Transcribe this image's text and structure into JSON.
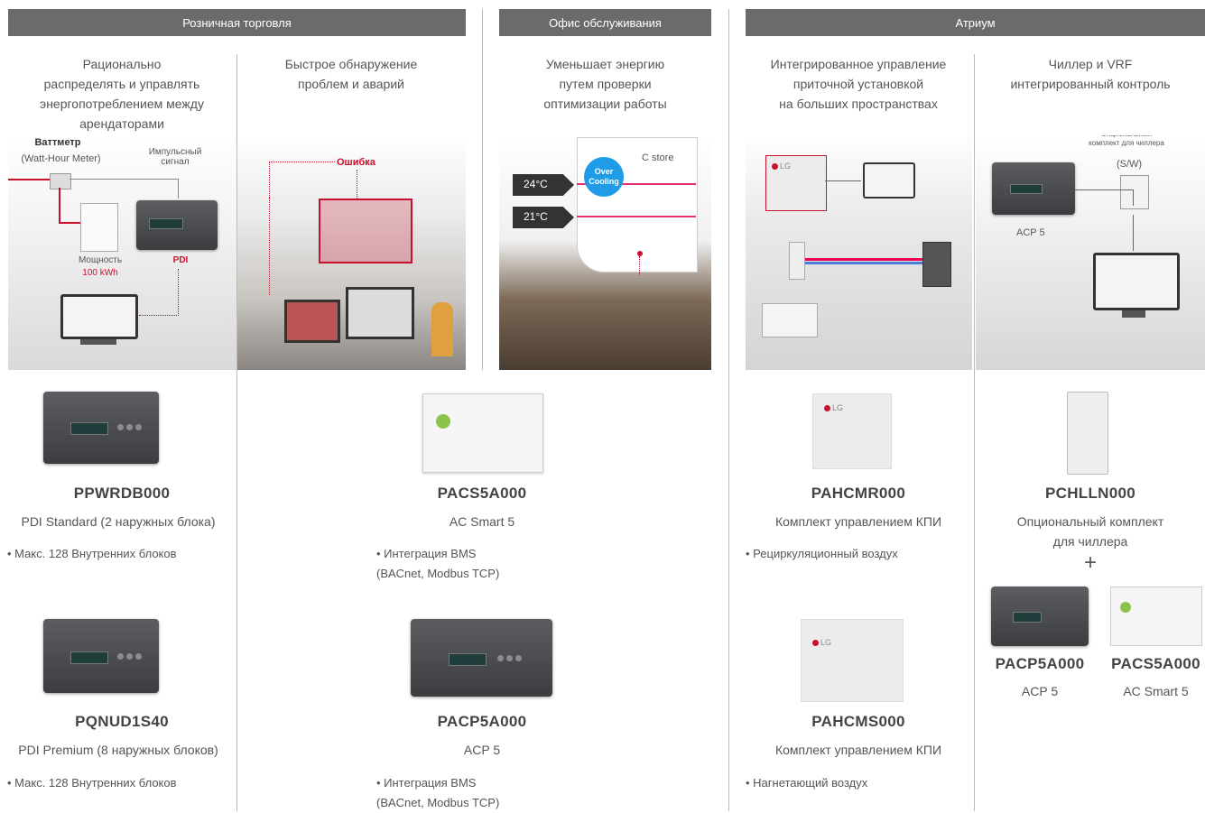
{
  "headers": {
    "retail": "Розничная торговля",
    "office": "Офис обслуживания",
    "atrium": "Атриум"
  },
  "columns": {
    "col1": {
      "desc": "Рационально\nраспределять и управлять\nэнергопотреблением между\nарендаторами",
      "diagram": {
        "wattmeter_title": "Ваттметр",
        "wattmeter_sub": "(Watt-Hour Meter)",
        "pulse": "Импульсный\nсигнал",
        "power_label": "Мощность",
        "power_value": "100 kWh",
        "pdi": "PDI"
      }
    },
    "col2": {
      "desc": "Быстрое обнаружение\nпроблем и аварий",
      "error_label": "Ошибка"
    },
    "col3": {
      "desc": "Уменьшает энергию\nпутем проверки\nоптимизации работы",
      "temp_high": "24°C",
      "temp_low": "21°C",
      "bubble": "Over\nCooling",
      "store": "C store"
    },
    "col4": {
      "desc": "Интегрированное управление\nприточной установкой\nна больших пространствах",
      "logo": "LG"
    },
    "col5": {
      "desc": "Чиллер и VRF\nинтегрированный контроль",
      "option_kit": "Опциональный\nкомплект для чиллера",
      "sw": "(S/W)",
      "acp": "ACP 5"
    }
  },
  "products": {
    "ppwrdb": {
      "code": "PPWRDB000",
      "name": "PDI Standard (2 наружных блока)",
      "bullet": "• Макс. 128 Внутренних блоков"
    },
    "pqnud": {
      "code": "PQNUD1S40",
      "name": "PDI Premium (8 наружных блоков)",
      "bullet": "• Макс. 128 Внутренних блоков"
    },
    "pacs5": {
      "code": "PACS5A000",
      "name": "AC Smart 5",
      "bullet": "• Интеграция BMS\n  (BACnet, Modbus TCP)"
    },
    "pacp5": {
      "code": "PACP5A000",
      "name": "ACP 5",
      "bullet": "• Интеграция BMS\n  (BACnet, Modbus TCP)"
    },
    "pahcmr": {
      "code": "PAHCMR000",
      "name": "Комплект управлением КПИ",
      "bullet": "• Рециркуляционный воздух"
    },
    "pahcms": {
      "code": "PAHCMS000",
      "name": "Комплект управлением КПИ",
      "bullet": "• Нагнетающий воздух"
    },
    "pchlln": {
      "code": "PCHLLN000",
      "name": "Опциональный комплект\nдля чиллера",
      "plus": "+"
    },
    "pacp5b": {
      "code": "PACP5A000",
      "name": "ACP 5"
    },
    "pacs5b": {
      "code": "PACS5A000",
      "name": "AC Smart 5"
    }
  },
  "colors": {
    "header_bg": "#6b6b6b",
    "accent": "#c8102e",
    "divider": "#bbbbbb"
  }
}
